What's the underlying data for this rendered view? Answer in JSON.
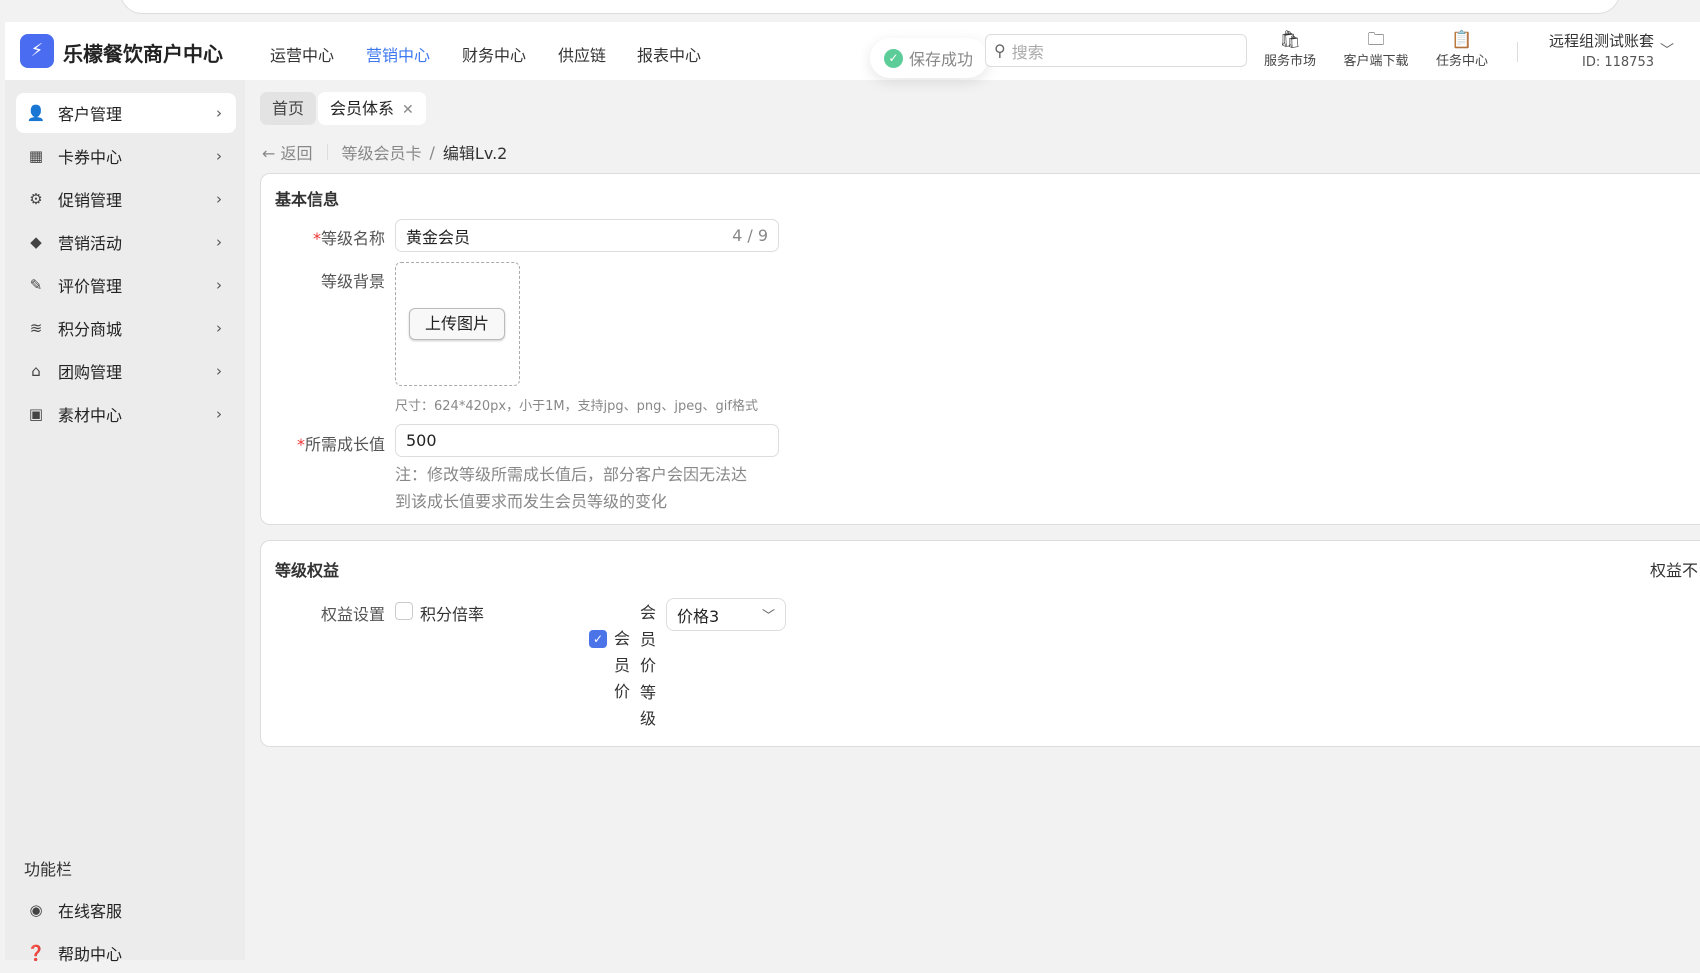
{
  "header": {
    "brand": "乐檬餐饮商户中心",
    "nav": [
      "运营中心",
      "营销中心",
      "财务中心",
      "供应链",
      "报表中心"
    ],
    "active_nav": "营销中心",
    "toast": "保存成功",
    "search_placeholder": "搜索",
    "tools": [
      {
        "label": "服务市场",
        "icon": "store-bag-icon"
      },
      {
        "label": "客户端下载",
        "icon": "folder-download-icon"
      },
      {
        "label": "任务中心",
        "icon": "clipboard-check-icon"
      }
    ],
    "account": "远程组测试账套",
    "account_id": "ID: 118753"
  },
  "sidebar": {
    "items": [
      {
        "label": "客户管理",
        "icon": "user-icon"
      },
      {
        "label": "卡券中心",
        "icon": "coupon-icon"
      },
      {
        "label": "促销管理",
        "icon": "discount-icon"
      },
      {
        "label": "营销活动",
        "icon": "tag-icon"
      },
      {
        "label": "评价管理",
        "icon": "edit-icon"
      },
      {
        "label": "积分商城",
        "icon": "coins-icon"
      },
      {
        "label": "团购管理",
        "icon": "store-icon"
      },
      {
        "label": "素材中心",
        "icon": "image-icon"
      }
    ],
    "func_title": "功能栏",
    "func_items": [
      {
        "label": "在线客服",
        "icon": "headset-icon"
      },
      {
        "label": "帮助中心",
        "icon": "help-icon"
      }
    ]
  },
  "tabs": [
    {
      "label": "首页"
    },
    {
      "label": "会员体系"
    }
  ],
  "breadcrumb": {
    "back": "返回",
    "parent": "等级会员卡",
    "sep": "/",
    "current": "编辑Lv.2"
  },
  "basic": {
    "title": "基本信息",
    "name_label": "等级名称",
    "name_value": "黄金会员",
    "name_count": "4 / 9",
    "bg_label": "等级背景",
    "upload_label": "上传图片",
    "upload_hint": "尺寸：624*420px，小于1M，支持jpg、png、jpeg、gif格式",
    "growth_label": "所需成长值",
    "growth_value": "500",
    "note1": "注：修改等级所需成长值后，部分客户会因无法达",
    "note2": "到该成长值要求而发生会员等级的变化"
  },
  "rights": {
    "title": "等级权益",
    "setting_label": "权益设置",
    "points_rate": "积分倍率",
    "points_checked": false,
    "member_price": "会员价",
    "member_price_checked": true,
    "member_price_level": "会员价等级",
    "price_select": "价格3",
    "right_text": "权益不"
  },
  "colors": {
    "accent": "#3d78f0",
    "success": "#5ccc99",
    "required": "#e33333"
  }
}
